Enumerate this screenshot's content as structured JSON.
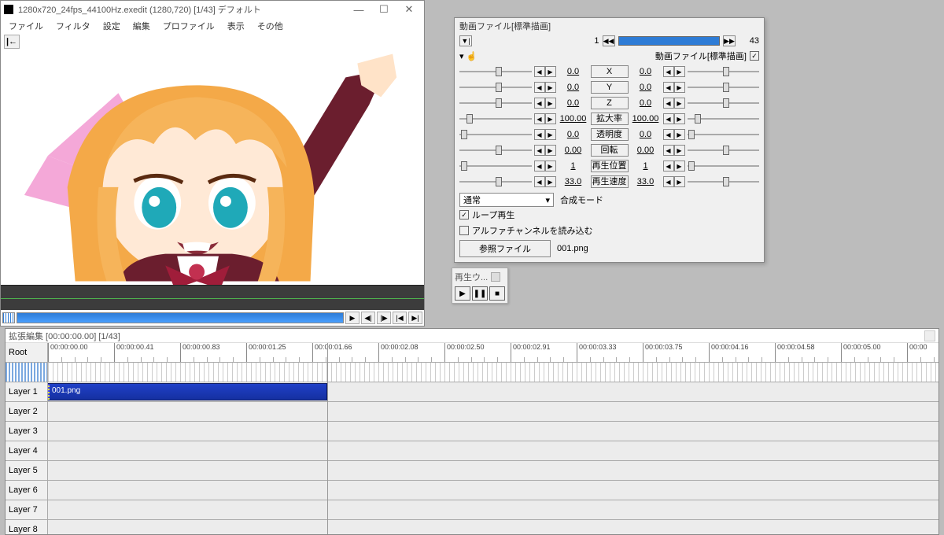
{
  "main_window": {
    "title": "1280x720_24fps_44100Hz.exedit (1280,720) [1/43] デフォルト",
    "menu": [
      "ファイル",
      "フィルタ",
      "設定",
      "編集",
      "プロファイル",
      "表示",
      "その他"
    ]
  },
  "property_panel": {
    "title": "動画ファイル[標準描画]",
    "frame_current": "1",
    "frame_total": "43",
    "header_label": "動画ファイル[標準描画]",
    "rows": [
      {
        "label": "X",
        "left_val": "0.0",
        "right_val": "0.0",
        "left_thumb": 50,
        "right_thumb": 50
      },
      {
        "label": "Y",
        "left_val": "0.0",
        "right_val": "0.0",
        "left_thumb": 50,
        "right_thumb": 50
      },
      {
        "label": "Z",
        "left_val": "0.0",
        "right_val": "0.0",
        "left_thumb": 50,
        "right_thumb": 50
      },
      {
        "label": "拡大率",
        "left_val": "100.00",
        "right_val": "100.00",
        "left_thumb": 10,
        "right_thumb": 10
      },
      {
        "label": "透明度",
        "left_val": "0.0",
        "right_val": "0.0",
        "left_thumb": 2,
        "right_thumb": 2
      },
      {
        "label": "回転",
        "left_val": "0.00",
        "right_val": "0.00",
        "left_thumb": 50,
        "right_thumb": 50
      },
      {
        "label": "再生位置",
        "left_val": "1",
        "right_val": "1",
        "left_thumb": 2,
        "right_thumb": 2
      },
      {
        "label": "再生速度",
        "left_val": "33.0",
        "right_val": "33.0",
        "left_thumb": 50,
        "right_thumb": 50
      }
    ],
    "blend_mode_label": "合成モード",
    "blend_mode_value": "通常",
    "loop_label": "ループ再生",
    "alpha_label": "アルファチャンネルを読み込む",
    "ref_button": "参照ファイル",
    "ref_file": "001.png"
  },
  "play_mini": {
    "title": "再生ウ..."
  },
  "timeline": {
    "title": "拡張編集 [00:00:00.00] [1/43]",
    "root_label": "Root",
    "layers": [
      "Layer 1",
      "Layer 2",
      "Layer 3",
      "Layer 4",
      "Layer 5",
      "Layer 6",
      "Layer 7",
      "Layer 8"
    ],
    "clip_name": "001.png",
    "ticks": [
      "00:00:00.00",
      "00:00:00.41",
      "00:00:00.83",
      "00:00:01.25",
      "00:00:01.66",
      "00:00:02.08",
      "00:00:02.50",
      "00:00:02.91",
      "00:00:03.33",
      "00:00:03.75",
      "00:00:04.16",
      "00:00:04.58",
      "00:00:05.00",
      "00:00"
    ]
  }
}
